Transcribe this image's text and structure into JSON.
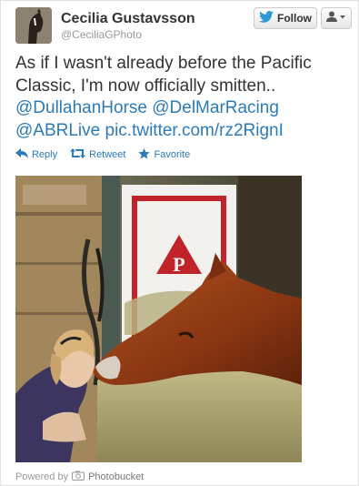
{
  "author": {
    "name": "Cecilia Gustavsson",
    "handle": "@CeciliaGPhoto"
  },
  "header_buttons": {
    "follow_label": "Follow",
    "bird_icon": "twitter-bird-icon",
    "user_menu_icon": "user-dropdown-icon"
  },
  "tweet": {
    "text_line1": "As if I wasn't already before the Pacific",
    "text_line2": "Classic, I'm now officially smitten..",
    "mention1": "@DullahanHorse",
    "mention2": "@DelMarRacing",
    "mention3": "@ABRLive",
    "link": "pic.twitter.com/rz2RignI"
  },
  "actions": [
    {
      "label": "Reply",
      "icon": "reply-icon"
    },
    {
      "label": "Retweet",
      "icon": "retweet-icon"
    },
    {
      "label": "Favorite",
      "icon": "star-icon"
    }
  ],
  "photo": {
    "stall_sign_letter": "P"
  },
  "footer": {
    "powered_by": "Powered by",
    "brand": "Photobucket"
  },
  "colors": {
    "link": "#2b7bb9",
    "twitter_blue": "#2b9ad5",
    "stall_sign_red": "#c0242a"
  }
}
